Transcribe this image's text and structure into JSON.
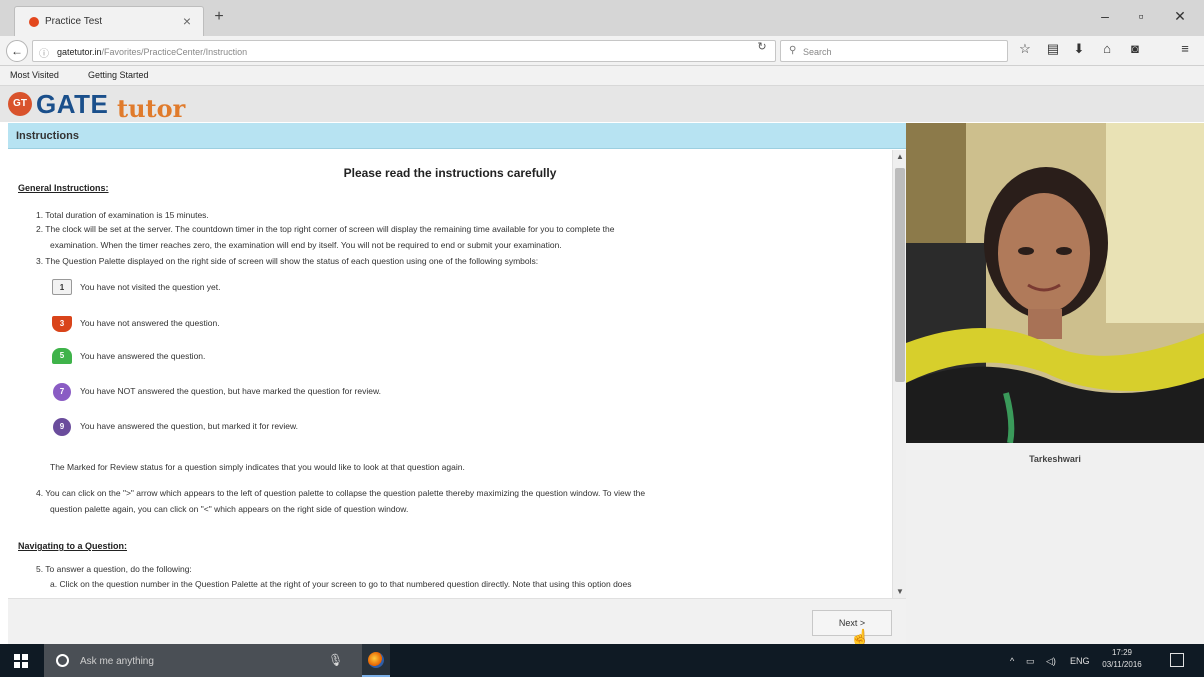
{
  "browser": {
    "tab_title": "Practice Test",
    "url_domain": "gatetutor.in",
    "url_path": "/Favorites/PracticeCenter/Instruction",
    "search_placeholder": "Search",
    "bookmarks": [
      "Most Visited",
      "Getting Started"
    ]
  },
  "page": {
    "logo": {
      "badge": "GT",
      "word1": "GATE",
      "word2": "tutor"
    },
    "section_header": "Instructions",
    "heading": "Please read the instructions carefully",
    "general_title": "General Instructions:",
    "general_items": {
      "i1": "1. Total duration of examination is 15 minutes.",
      "i2a": "2. The clock will be set at the server. The countdown timer in the top right corner of screen will display the remaining time available for you to complete the",
      "i2b": "examination. When the timer reaches zero, the examination will end by itself. You will not be required to end or submit your examination.",
      "i3": "3. The Question Palette displayed on the right side of screen will show the status of each question using one of the following symbols:"
    },
    "symbols": [
      {
        "num": "1",
        "text": "You have not visited the question yet."
      },
      {
        "num": "3",
        "text": "You have not answered the question."
      },
      {
        "num": "5",
        "text": "You have answered the question."
      },
      {
        "num": "7",
        "text": "You have NOT answered the question, but have marked the question for review."
      },
      {
        "num": "9",
        "text": "You have answered the question, but marked it for review."
      }
    ],
    "marked_note": "The Marked for Review status for a question simply indicates that you would like to look at that question again.",
    "item4a": "4. You can click on the \">\" arrow which appears to the left of question palette to collapse the question palette thereby maximizing the question window. To view the",
    "item4b": "question palette again, you can click on \"<\" which appears on the right side of question window.",
    "nav_title": "Navigating to a Question:",
    "item5": "5. To answer a question, do the following:",
    "item5a": "a. Click on the question number in the Question Palette at the right of your screen to go to that numbered question directly. Note that using this option does",
    "next_label": "Next >",
    "candidate_name": "Tarkeshwari"
  },
  "taskbar": {
    "search_placeholder": "Ask me anything",
    "lang": "ENG",
    "time": "17:29",
    "date": "03/11/2016"
  },
  "colors": {
    "header_bg": "#b7e3f2",
    "logo_blue": "#1a4f8b",
    "logo_orange": "#e07b2c",
    "not_answered": "#d9441a",
    "answered": "#3fb34a",
    "marked": "#8a5cc4"
  }
}
